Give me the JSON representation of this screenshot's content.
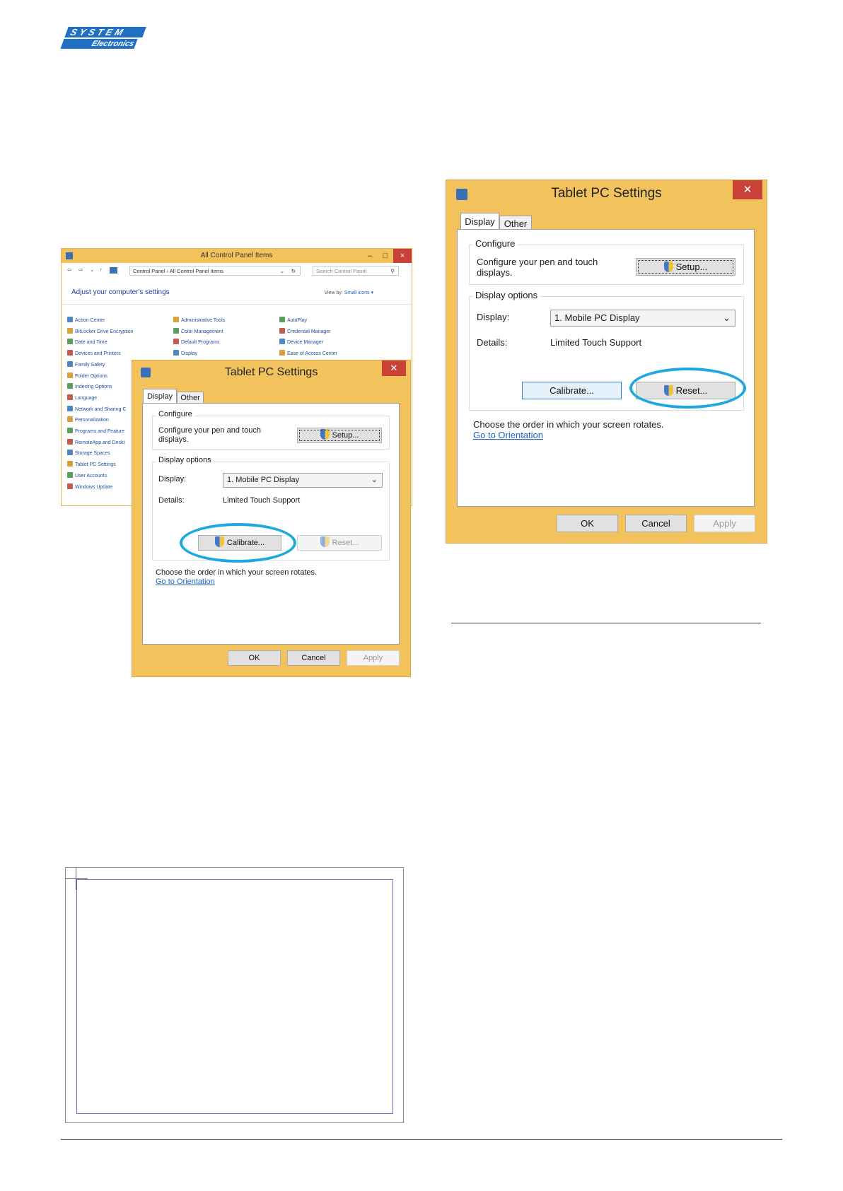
{
  "logo": {
    "line1": "SYSTEM",
    "line2": "Electronics"
  },
  "control_panel": {
    "title": "All Control Panel Items",
    "window_controls": [
      "–",
      "□",
      "×"
    ],
    "nav_glyphs": [
      "⇦",
      "⇨",
      "⌄",
      "↑"
    ],
    "address": "Control Panel  ›  All Control Panel Items",
    "address_glyphs": [
      "⌄",
      "↻"
    ],
    "search_placeholder": "Search Control Panel",
    "search_glyph": "⚲",
    "heading": "Adjust your computer's settings",
    "view_by_label": "View by:",
    "view_by_value": "Small icons ▾",
    "col1": [
      "Action Center",
      "BitLocker Drive Encryption",
      "Date and Time",
      "Devices and Printers",
      "Family Safety",
      "Folder Options",
      "Indexing Options",
      "Language",
      "Network and Sharing C",
      "Personalization",
      "Programs and Feature",
      "RemoteApp and Deskt",
      "Storage Spaces",
      "Tablet PC Settings",
      "User Accounts",
      "Windows Update"
    ],
    "col2": [
      "Administrative Tools",
      "Color Management",
      "Default Programs",
      "Display"
    ],
    "col3": [
      "AutoPlay",
      "Credential Manager",
      "Device Manager",
      "Ease of Access Center"
    ]
  },
  "dialog_left": {
    "title": "Tablet PC Settings",
    "close_glyph": "✕",
    "tab_display": "Display",
    "tab_other": "Other",
    "configure_label": "Configure",
    "configure_text": "Configure your pen and touch displays.",
    "setup_label": "Setup...",
    "display_options_label": "Display options",
    "display_label": "Display:",
    "display_value": "1. Mobile PC Display",
    "select_arrow": "⌄",
    "details_label": "Details:",
    "details_value": "Limited Touch Support",
    "calibrate_label": "Calibrate...",
    "reset_label": "Reset...",
    "rotate_text": "Choose the order in which your screen rotates.",
    "orientation_link": "Go to Orientation",
    "ok_label": "OK",
    "cancel_label": "Cancel",
    "apply_label": "Apply"
  },
  "dialog_right": {
    "title": "Tablet PC Settings",
    "close_glyph": "✕",
    "tab_display": "Display",
    "tab_other": "Other",
    "configure_label": "Configure",
    "configure_text": "Configure your pen and touch displays.",
    "setup_label": "Setup...",
    "display_options_label": "Display options",
    "display_label": "Display:",
    "display_value": "1. Mobile PC Display",
    "select_arrow": "⌄",
    "details_label": "Details:",
    "details_value": "Limited Touch Support",
    "calibrate_label": "Calibrate...",
    "reset_label": "Reset...",
    "rotate_text": "Choose the order in which your screen rotates.",
    "orientation_link": "Go to Orientation",
    "ok_label": "OK",
    "cancel_label": "Cancel",
    "apply_label": "Apply"
  },
  "colors": {
    "window_frame": "#f2c25d",
    "highlight_ring": "#1fa7e0",
    "close_button": "#c94238",
    "link": "#1f63c6",
    "logo_blue": "#1f6fc2"
  }
}
